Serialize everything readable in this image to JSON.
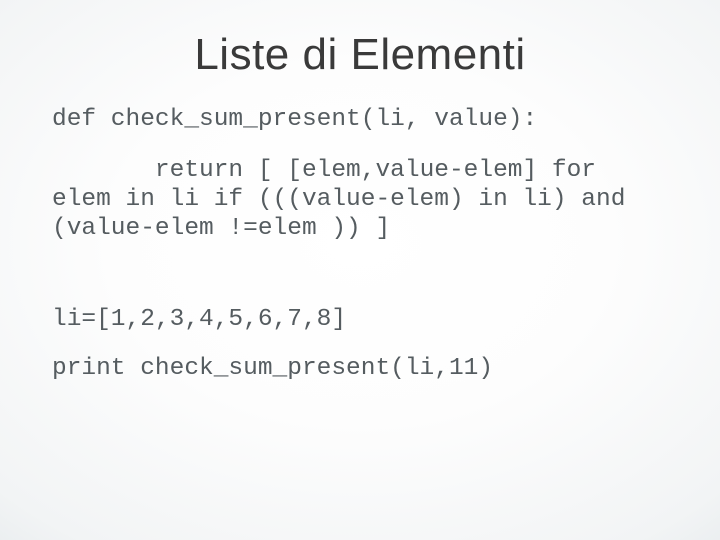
{
  "slide": {
    "title": "Liste di Elementi",
    "line1": "def check_sum_present(li, value):",
    "line2": "       return [ [elem,value-elem] for elem in li if (((value-elem) in li) and (value-elem !=elem )) ]",
    "line3": "li=[1,2,3,4,5,6,7,8]",
    "line4": "print check_sum_present(li,11)"
  }
}
